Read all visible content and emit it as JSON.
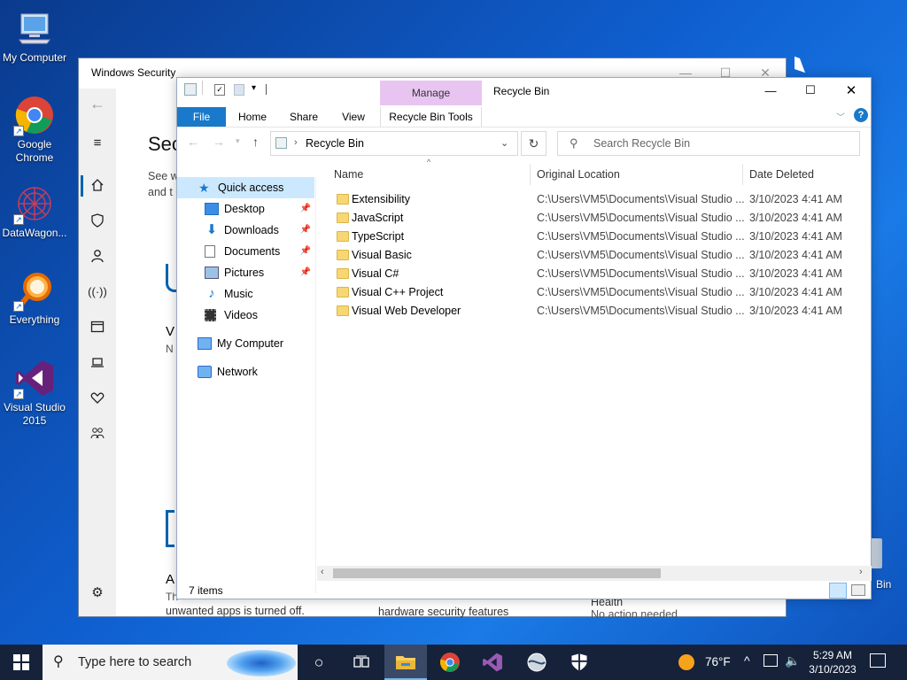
{
  "desktop": {
    "icons": [
      {
        "label": "My Computer"
      },
      {
        "label": "Google Chrome"
      },
      {
        "label": "DataWagon..."
      },
      {
        "label": "Everything"
      },
      {
        "label": "Visual Studio 2015"
      }
    ],
    "recycle_partial": "Bin"
  },
  "security_window": {
    "title": "Windows Security",
    "heading_partial": "Sec",
    "desc_line1": "See w",
    "desc_line2": "and t",
    "v_partial": "V",
    "n_partial": "N",
    "a_partial": "A",
    "th_partial": "Th",
    "bottom_text1": "unwanted apps is turned off.",
    "bottom_text2": "hardware security features",
    "bottom_text3": "No action needed",
    "bottom_text4": "Health"
  },
  "explorer": {
    "title": "Recycle Bin",
    "context_tab": "Manage",
    "tabs": [
      "File",
      "Home",
      "Share",
      "View",
      "Recycle Bin Tools"
    ],
    "address": "Recycle Bin",
    "search_placeholder": "Search Recycle Bin",
    "nav": {
      "quick_access": "Quick access",
      "items": [
        "Desktop",
        "Downloads",
        "Documents",
        "Pictures",
        "Music",
        "Videos"
      ],
      "my_computer": "My Computer",
      "network": "Network"
    },
    "columns": [
      "Name",
      "Original Location",
      "Date Deleted"
    ],
    "rows": [
      {
        "name": "Extensibility",
        "location": "C:\\Users\\VM5\\Documents\\Visual Studio ...",
        "date": "3/10/2023 4:41 AM"
      },
      {
        "name": "JavaScript",
        "location": "C:\\Users\\VM5\\Documents\\Visual Studio ...",
        "date": "3/10/2023 4:41 AM"
      },
      {
        "name": "TypeScript",
        "location": "C:\\Users\\VM5\\Documents\\Visual Studio ...",
        "date": "3/10/2023 4:41 AM"
      },
      {
        "name": "Visual Basic",
        "location": "C:\\Users\\VM5\\Documents\\Visual Studio ...",
        "date": "3/10/2023 4:41 AM"
      },
      {
        "name": "Visual C#",
        "location": "C:\\Users\\VM5\\Documents\\Visual Studio ...",
        "date": "3/10/2023 4:41 AM"
      },
      {
        "name": "Visual C++ Project",
        "location": "C:\\Users\\VM5\\Documents\\Visual Studio ...",
        "date": "3/10/2023 4:41 AM"
      },
      {
        "name": "Visual Web Developer",
        "location": "C:\\Users\\VM5\\Documents\\Visual Studio ...",
        "date": "3/10/2023 4:41 AM"
      }
    ],
    "status": "7 items"
  },
  "taskbar": {
    "search_placeholder": "Type here to search",
    "weather": "76°F",
    "time": "5:29 AM",
    "date": "3/10/2023"
  }
}
